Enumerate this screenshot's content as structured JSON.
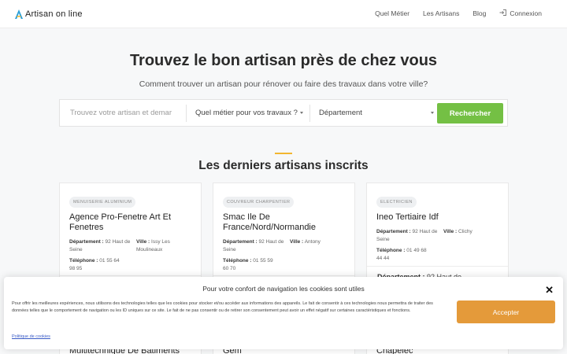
{
  "nav": {
    "logo_text": "Artisan on line",
    "links": [
      "Quel Métier",
      "Les Artisans",
      "Blog"
    ],
    "login": "Connexion"
  },
  "hero": {
    "title": "Trouvez le bon artisan près de chez vous",
    "subtitle": "Comment trouver un artisan pour rénover ou faire des travaux dans votre ville?"
  },
  "search": {
    "placeholder": "Trouvez votre artisan et demar",
    "metier": "Quel métier pour vos travaux ?",
    "departement": "Département",
    "button": "Rechercher"
  },
  "section": {
    "title": "Les derniers artisans inscrits"
  },
  "cards": [
    {
      "tag": "Menuiserie Aluminium",
      "title": "Agence Pro-Fenetre Art Et Fenetres",
      "dept_label": "Département :",
      "dept_value": "92 Haut de Seine",
      "ville_label": "Ville :",
      "ville_value": "Issy Les Moulineaux",
      "tel_label": "Téléphone :",
      "tel_value": "01 55 64 98 95"
    },
    {
      "tag": "Couvreur Charpentier",
      "title": "Smac Ile De France/Nord/Normandie",
      "dept_label": "Département :",
      "dept_value": "92 Haut de Seine",
      "ville_label": "Ville :",
      "ville_value": "Antony",
      "tel_label": "Téléphone :",
      "tel_value": "01 55 59 60 70"
    },
    {
      "tag": "Electricien",
      "title": "Ineo Tertiaire Idf",
      "dept_label": "Département :",
      "dept_value": "92 Haut de Seine",
      "ville_label": "Ville :",
      "ville_value": "Clichy",
      "tel_label": "Téléphone :",
      "tel_value": "01 49 68 44 44",
      "more_label": "Département :",
      "more_value": "92 Haut de"
    }
  ],
  "next_titles": [
    "Multitechnique De Batiments",
    "Gem",
    "Chapelec"
  ],
  "cookie": {
    "title": "Pour votre confort de navigation les cookies sont utiles",
    "text": "Pour offrir les meilleures expériences, nous utilisons des technologies telles que les cookies pour stocker et/ou accéder aux informations des appareils. Le fait de consentir à ces technologies nous permettra de traiter des données telles que le comportement de navigation ou les ID uniques sur ce site. Le fait de ne pas consentir ou de retirer son consentement peut avoir un effet négatif sur certaines caractéristiques et fonctions.",
    "policy": "Politique de cookies",
    "accept": "Accepter",
    "close": "✕"
  },
  "colors": {
    "accent_green": "#74c044",
    "accent_orange": "#e49a3a",
    "accent_yellow": "#f2b630"
  }
}
